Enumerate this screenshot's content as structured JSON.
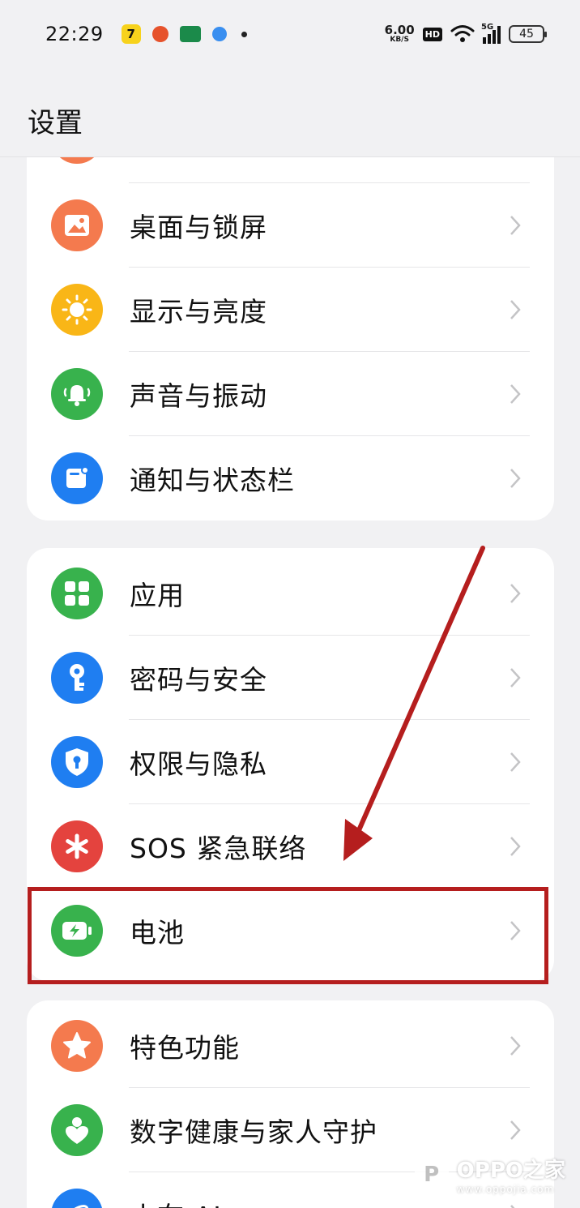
{
  "status_bar": {
    "time": "22:29",
    "net_speed_value": "6.00",
    "net_speed_unit": "KB/S",
    "hd_label": "HD",
    "signal_label": "5G",
    "battery_level": "45",
    "notification_icons": [
      "app-7-icon",
      "app-orange-icon",
      "oppo-app-icon",
      "app-blue-icon"
    ]
  },
  "header": {
    "title": "设置"
  },
  "cards": [
    {
      "items": [
        {
          "label": "桌面与锁屏",
          "icon": "wallpaper-icon",
          "color": "#f47a4e"
        },
        {
          "label": "显示与亮度",
          "icon": "brightness-icon",
          "color": "#f9b617"
        },
        {
          "label": "声音与振动",
          "icon": "bell-icon",
          "color": "#38b24d"
        },
        {
          "label": "通知与状态栏",
          "icon": "notification-icon",
          "color": "#1f7ef1"
        }
      ]
    },
    {
      "items": [
        {
          "label": "应用",
          "icon": "apps-icon",
          "color": "#38b24d"
        },
        {
          "label": "密码与安全",
          "icon": "key-icon",
          "color": "#1f7ef1"
        },
        {
          "label": "权限与隐私",
          "icon": "shield-icon",
          "color": "#1f7ef1"
        },
        {
          "label": "SOS 紧急联络",
          "icon": "sos-icon",
          "color": "#e4433e"
        },
        {
          "label": "电池",
          "icon": "battery-icon",
          "color": "#38b24d"
        }
      ]
    },
    {
      "items": [
        {
          "label": "特色功能",
          "icon": "star-icon",
          "color": "#f47a4e"
        },
        {
          "label": "数字健康与家人守护",
          "icon": "wellbeing-icon",
          "color": "#38b24d"
        },
        {
          "label": "小布 AI",
          "icon": "ai-icon",
          "color": "#1f7ef1"
        }
      ]
    }
  ],
  "watermark": {
    "main": "OPPO之家",
    "sub": "www.oppojia.com"
  }
}
